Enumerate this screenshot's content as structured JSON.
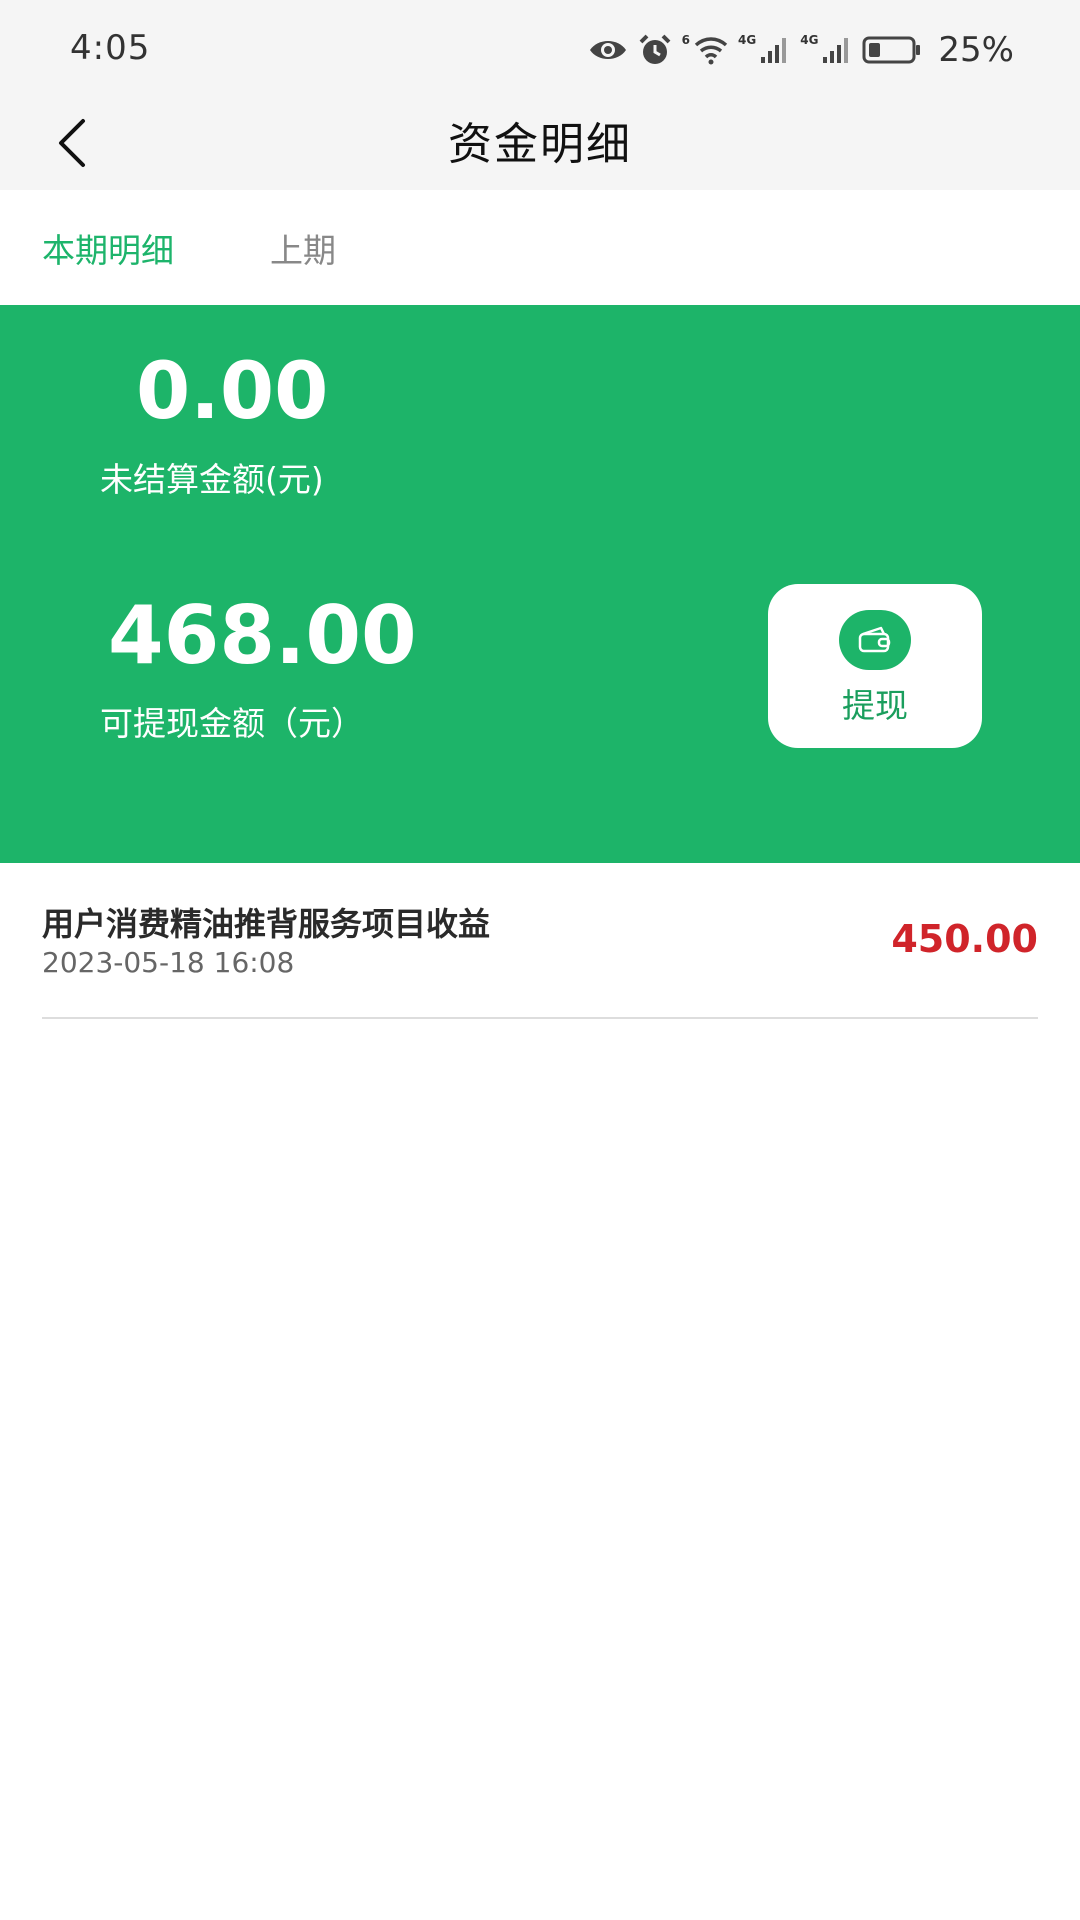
{
  "status_bar": {
    "time": "4:05",
    "battery_percent": "25%",
    "network_labels": [
      "6",
      "4G",
      "4G"
    ],
    "icons": [
      "eye-icon",
      "alarm-icon",
      "wifi-icon",
      "signal-icon",
      "signal-icon",
      "battery-icon"
    ]
  },
  "header": {
    "title": "资金明细",
    "back_icon": "chevron-left-icon"
  },
  "tabs": [
    {
      "label": "本期明细",
      "active": true
    },
    {
      "label": "上期",
      "active": false
    }
  ],
  "summary": {
    "unsettled_amount": "0.00",
    "unsettled_label": "未结算金额(元)",
    "withdrawable_amount": "468.00",
    "withdrawable_label": "可提现金额（元）",
    "withdraw_button_label": "提现",
    "withdraw_icon": "wallet-icon"
  },
  "transactions": [
    {
      "title": "用户消费精油推背服务项目收益",
      "time": "2023-05-18 16:08",
      "amount": "450.00"
    }
  ],
  "colors": {
    "accent_green": "#1db469",
    "tab_active": "#1db46b",
    "amount_red": "#d0242a",
    "status_bg": "#f5f5f5"
  }
}
